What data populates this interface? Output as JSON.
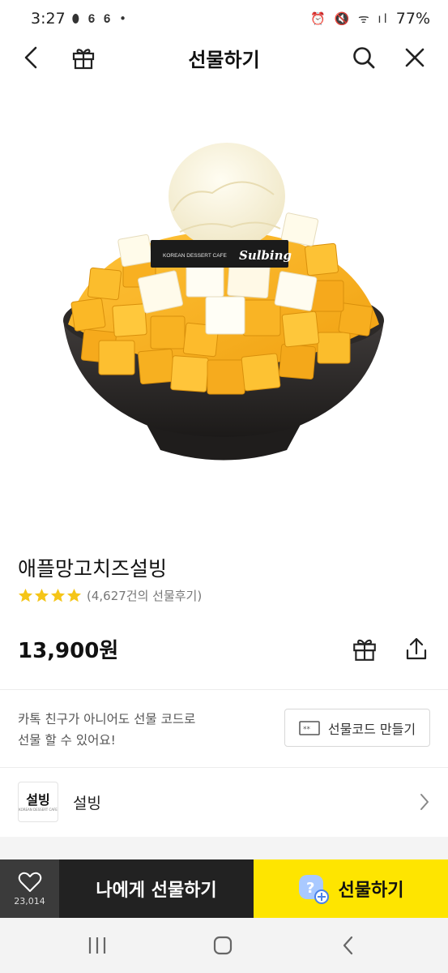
{
  "status_bar": {
    "time": "3:27",
    "battery": "77%",
    "notification_icons": [
      "link-icon",
      "fire-icon",
      "fire-icon",
      "dot-icon"
    ],
    "system_icons": [
      "alarm-icon",
      "mute-icon",
      "wifi-icon",
      "hd-voice-icon",
      "signal-icon",
      "battery-icon"
    ]
  },
  "header": {
    "title": "선물하기",
    "left_icons": [
      "back-icon",
      "gift-icon"
    ],
    "right_icons": [
      "search-icon",
      "close-icon"
    ]
  },
  "product": {
    "image": {
      "brand_tag": "KOREAN DESSERT CAFE",
      "brand_script": "Sulbing"
    },
    "name": "애플망고치즈설빙",
    "rating_stars": 4,
    "review_text": "(4,627건의 선물후기)",
    "price": "13,900원"
  },
  "gift_code": {
    "line1": "카톡 친구가 아니어도 선물 코드로",
    "line2": "선물 할 수 있어요!",
    "button_label": "선물코드 만들기"
  },
  "brand": {
    "logo_text": "설빙",
    "logo_sub": "KOREAN DESSERT CAFE",
    "name": "설빙"
  },
  "bottom_bar": {
    "like_count": "23,014",
    "self_gift_label": "나에게 선물하기",
    "gift_label": "선물하기"
  },
  "colors": {
    "accent_yellow": "#fee500",
    "dark_button": "#222222",
    "like_button": "#3b3b3b",
    "star": "#f5c518"
  }
}
